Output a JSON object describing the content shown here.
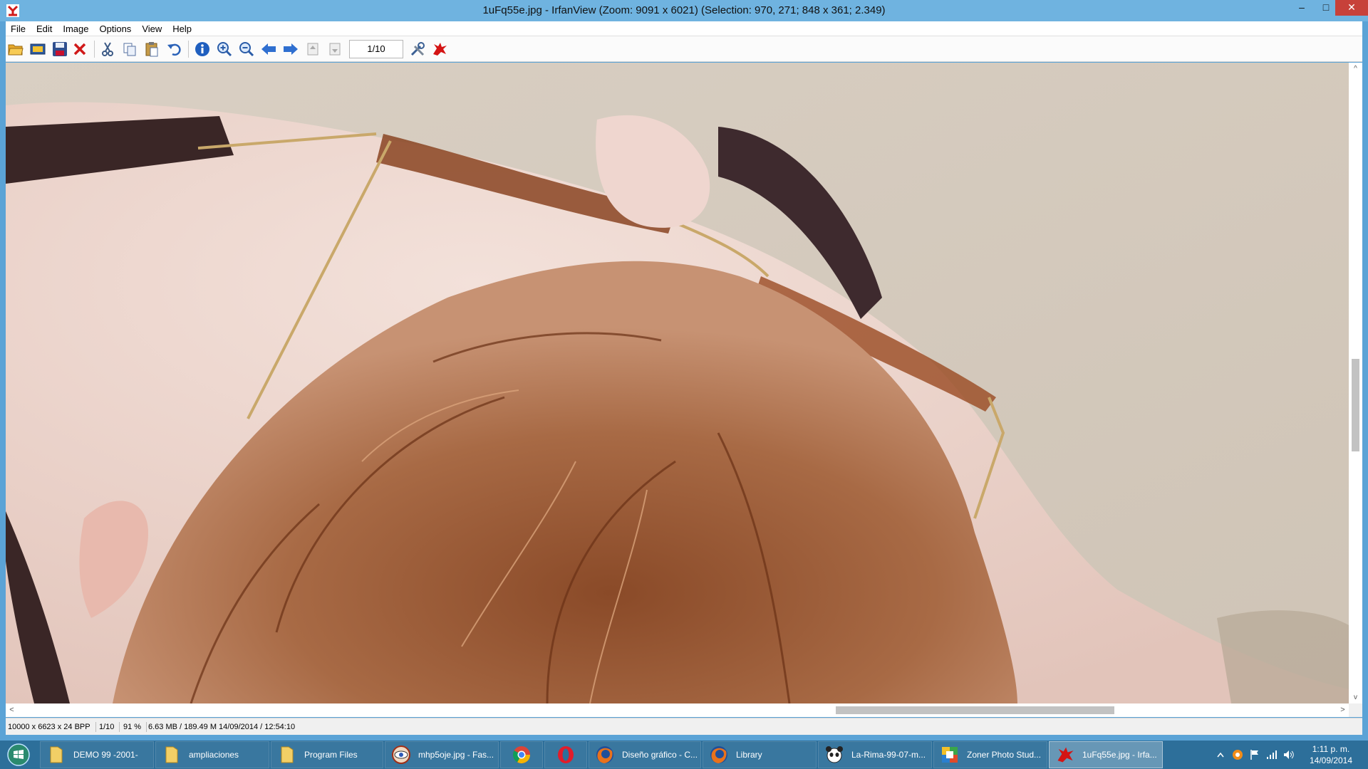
{
  "window": {
    "title": "1uFq55e.jpg - IrfanView (Zoom: 9091 x 6021) (Selection: 970, 271; 848 x 361; 2.349)",
    "controls": {
      "minimize": "–",
      "maximize": "□",
      "close": "✕"
    }
  },
  "menu": [
    "File",
    "Edit",
    "Image",
    "Options",
    "View",
    "Help"
  ],
  "toolbar": {
    "buttons": [
      "open-folder-icon",
      "slideshow-icon",
      "save-icon",
      "delete-icon",
      "cut-icon",
      "copy-icon",
      "paste-icon",
      "undo-icon",
      "info-icon",
      "zoom-in-icon",
      "zoom-out-icon",
      "previous-icon",
      "next-icon",
      "first-page-icon",
      "last-page-icon",
      "settings-icon",
      "irfanview-logo-icon"
    ],
    "page_indicator": "1/10"
  },
  "status": {
    "dimensions": "10000 x 6623 x 24 BPP",
    "page": "1/10",
    "zoom": "91 %",
    "size_date": "6.63 MB / 189.49 M 14/09/2014 / 12:54:10"
  },
  "scroll": {
    "left_arrow": "<",
    "right_arrow": ">",
    "up_arrow": "^",
    "down_arrow": "v"
  },
  "taskbar": {
    "items": [
      {
        "label": "DEMO 99 -2001-",
        "icon": "folder-icon"
      },
      {
        "label": "ampliaciones",
        "icon": "folder-icon"
      },
      {
        "label": "Program Files",
        "icon": "folder-icon"
      },
      {
        "label": "mhp5oje.jpg - Fas...",
        "icon": "faststone-viewer-icon"
      },
      {
        "label": "",
        "icon": "chrome-icon"
      },
      {
        "label": "",
        "icon": "opera-icon"
      },
      {
        "label": "Diseño gráfico - C...",
        "icon": "firefox-icon"
      },
      {
        "label": "Library",
        "icon": "firefox-icon"
      },
      {
        "label": "La-Rima-99-07-m...",
        "icon": "panda-icon"
      },
      {
        "label": "Zoner Photo Stud...",
        "icon": "zoner-icon"
      },
      {
        "label": "1uFq55e.jpg - Irfa...",
        "icon": "irfanview-icon",
        "active": true
      }
    ],
    "clock_time": "1:11 p. m.",
    "clock_date": "14/09/2014"
  }
}
